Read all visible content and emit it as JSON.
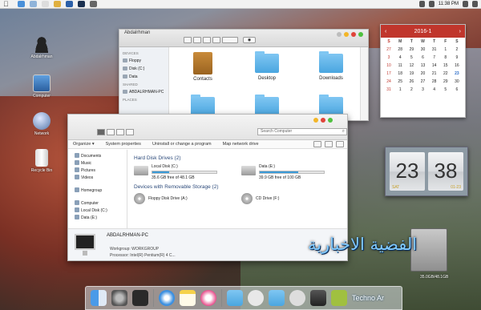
{
  "menubar": {
    "clock": "11:38 PM"
  },
  "desktop": {
    "icons": [
      {
        "label": "Abdalrhman"
      },
      {
        "label": "Computer"
      },
      {
        "label": "Network"
      },
      {
        "label": "Recycle Bin"
      }
    ]
  },
  "finder": {
    "title": "Abdalrhman",
    "sidebar": {
      "devices_header": "DEVICES",
      "devices": [
        "Floppy",
        "Disk (C:)",
        "Data"
      ],
      "shared_header": "SHARED",
      "shared": [
        "ABDALRHMAN-PC"
      ],
      "places_header": "PLACES"
    },
    "items": [
      {
        "label": "Contacts"
      },
      {
        "label": "Desktop"
      },
      {
        "label": "Downloads"
      }
    ]
  },
  "explorer": {
    "search_placeholder": "Search Computer",
    "commands": [
      "Organize ▾",
      "System properties",
      "Uninstall or change a program",
      "Map network drive"
    ],
    "sidebar": [
      "Documents",
      "Music",
      "Pictures",
      "Videos",
      "Homegroup",
      "Computer",
      "Local Disk (C:)",
      "Data (E:)"
    ],
    "hdd_group": "Hard Disk Drives (2)",
    "drives": [
      {
        "name": "Local Disk (C:)",
        "free": "35.6 GB free of 48.1 GB",
        "used_fraction": 0.26
      },
      {
        "name": "Data (E:)",
        "free": "39.9 GB free of 100 GB",
        "used_fraction": 0.6
      }
    ],
    "removable_group": "Devices with Removable Storage (2)",
    "removable": [
      "Floppy Disk Drive (A:)",
      "CD Drive (F:)"
    ],
    "details": {
      "name": "ABDALRHMAN-PC",
      "workgroup": "Workgroup: WORKGROUP",
      "processor": "Processor: Intel(R) Pentium(R) 4 C..."
    }
  },
  "calendar": {
    "month": "2016-1",
    "prev": "‹",
    "next": "›",
    "weekdays": [
      "S",
      "M",
      "T",
      "W",
      "T",
      "F",
      "S"
    ],
    "rows": [
      [
        "27",
        "28",
        "29",
        "30",
        "31",
        "1",
        "2"
      ],
      [
        "3",
        "4",
        "5",
        "6",
        "7",
        "8",
        "9"
      ],
      [
        "10",
        "11",
        "12",
        "13",
        "14",
        "15",
        "16"
      ],
      [
        "17",
        "18",
        "19",
        "20",
        "21",
        "22",
        "23"
      ],
      [
        "24",
        "25",
        "26",
        "27",
        "28",
        "29",
        "30"
      ],
      [
        "31",
        "1",
        "2",
        "3",
        "4",
        "5",
        "6"
      ]
    ]
  },
  "flipclock": {
    "hours": "23",
    "minutes": "38",
    "day": "SAT",
    "date": "01-23"
  },
  "drive_widget": {
    "label": "35.0GB/48.1GB"
  },
  "watermark": "الفضية الاخبارية",
  "dock": {
    "text_label": "Techno Ar"
  }
}
